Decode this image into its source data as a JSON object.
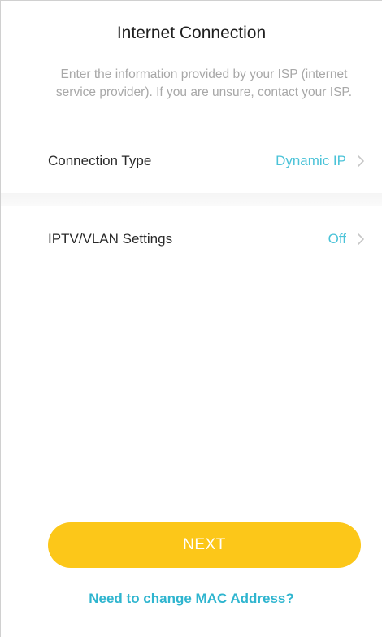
{
  "header": {
    "title": "Internet Connection"
  },
  "description": "Enter the information provided by your ISP (internet service provider). If you are unsure, contact your ISP.",
  "settings": [
    {
      "label": "Connection Type",
      "value": "Dynamic IP"
    },
    {
      "label": "IPTV/VLAN Settings",
      "value": "Off"
    }
  ],
  "actions": {
    "next_label": "NEXT",
    "mac_link": "Need to change MAC Address?"
  },
  "icons": {
    "row_chevron": "chevron-right-icon"
  },
  "colors": {
    "accent": "#4bc3d8",
    "link": "#2fb5cf",
    "primary_button": "#fcc719",
    "muted_text": "#a8a8a8"
  }
}
